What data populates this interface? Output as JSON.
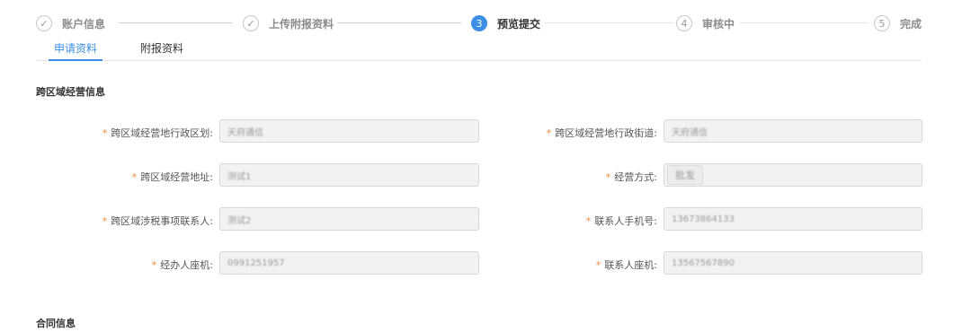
{
  "steps": [
    {
      "label": "账户信息",
      "state": "done",
      "num": "✓"
    },
    {
      "label": "上传附报资料",
      "state": "done",
      "num": "✓"
    },
    {
      "label": "预览提交",
      "state": "active",
      "num": "3"
    },
    {
      "label": "审核中",
      "state": "pending",
      "num": "4"
    },
    {
      "label": "完成",
      "state": "pending",
      "num": "5"
    }
  ],
  "tabs": [
    {
      "label": "申请资料",
      "active": true
    },
    {
      "label": "附报资料",
      "active": false
    }
  ],
  "sections": {
    "cross_region": "跨区域经营信息",
    "contract": "合同信息"
  },
  "fields": {
    "left": [
      {
        "label": "跨区域经营地行政区划:",
        "value": "天府通信",
        "required": true
      },
      {
        "label": "跨区域经营地址:",
        "value": "测试1",
        "required": true
      },
      {
        "label": "跨区域涉税事项联系人:",
        "value": "测试2",
        "required": true
      },
      {
        "label": "经办人座机:",
        "value": "0991251957",
        "required": true
      }
    ],
    "right": [
      {
        "label": "跨区域经营地行政街道:",
        "value": "天府通信",
        "required": true
      },
      {
        "label": "经营方式:",
        "value": "批发",
        "required": true,
        "kind": "chip"
      },
      {
        "label": "联系人手机号:",
        "value": "13673864133",
        "required": true
      },
      {
        "label": "联系人座机:",
        "value": "13567567890",
        "required": true
      }
    ]
  },
  "required_mark": "*"
}
